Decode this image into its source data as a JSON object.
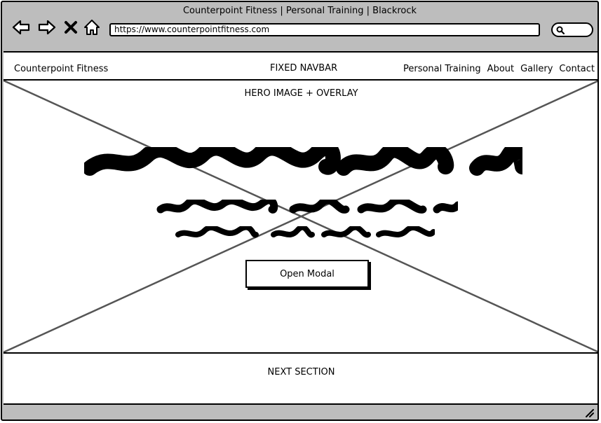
{
  "browser": {
    "window_title": "Counterpoint Fitness | Personal Training | Blackrock",
    "url": "https://www.counterpointfitness.com",
    "icons": [
      "back-arrow-icon",
      "forward-arrow-icon",
      "close-x-icon",
      "home-icon",
      "search-icon"
    ]
  },
  "navbar": {
    "brand": "Counterpoint Fitness",
    "label": "FIXED NAVBAR",
    "links": [
      "Personal Training",
      "About",
      "Gallery",
      "Contact"
    ]
  },
  "hero": {
    "label": "HERO IMAGE + OVERLAY",
    "button_label": "Open Modal"
  },
  "next_section": {
    "label": "NEXT SECTION"
  }
}
